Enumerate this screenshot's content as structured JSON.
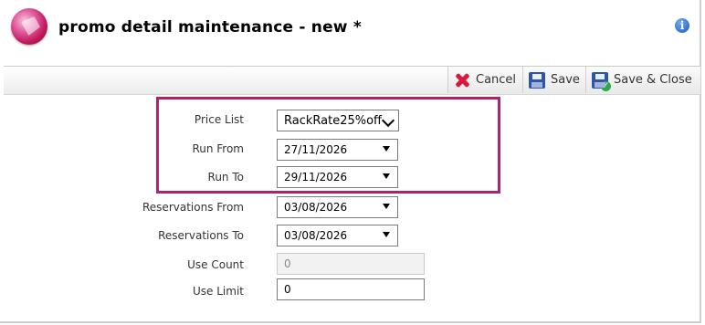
{
  "header": {
    "title": "promo detail maintenance - new *",
    "info_icon": "i"
  },
  "toolbar": {
    "cancel_label": "Cancel",
    "save_label": "Save",
    "save_close_label": "Save & Close"
  },
  "form": {
    "price_list": {
      "label": "Price List",
      "value": "RackRate25%off"
    },
    "run_from": {
      "label": "Run From",
      "value": "27/11/2026"
    },
    "run_to": {
      "label": "Run To",
      "value": "29/11/2026"
    },
    "reservations_from": {
      "label": "Reservations From",
      "value": "03/08/2026"
    },
    "reservations_to": {
      "label": "Reservations To",
      "value": "03/08/2026"
    },
    "use_count": {
      "label": "Use Count",
      "value": "0"
    },
    "use_limit": {
      "label": "Use Limit",
      "value": "0"
    }
  },
  "colors": {
    "highlight_border": "#b0226e",
    "cancel_icon": "#d81b3c",
    "save_icon": "#2f55a8"
  }
}
